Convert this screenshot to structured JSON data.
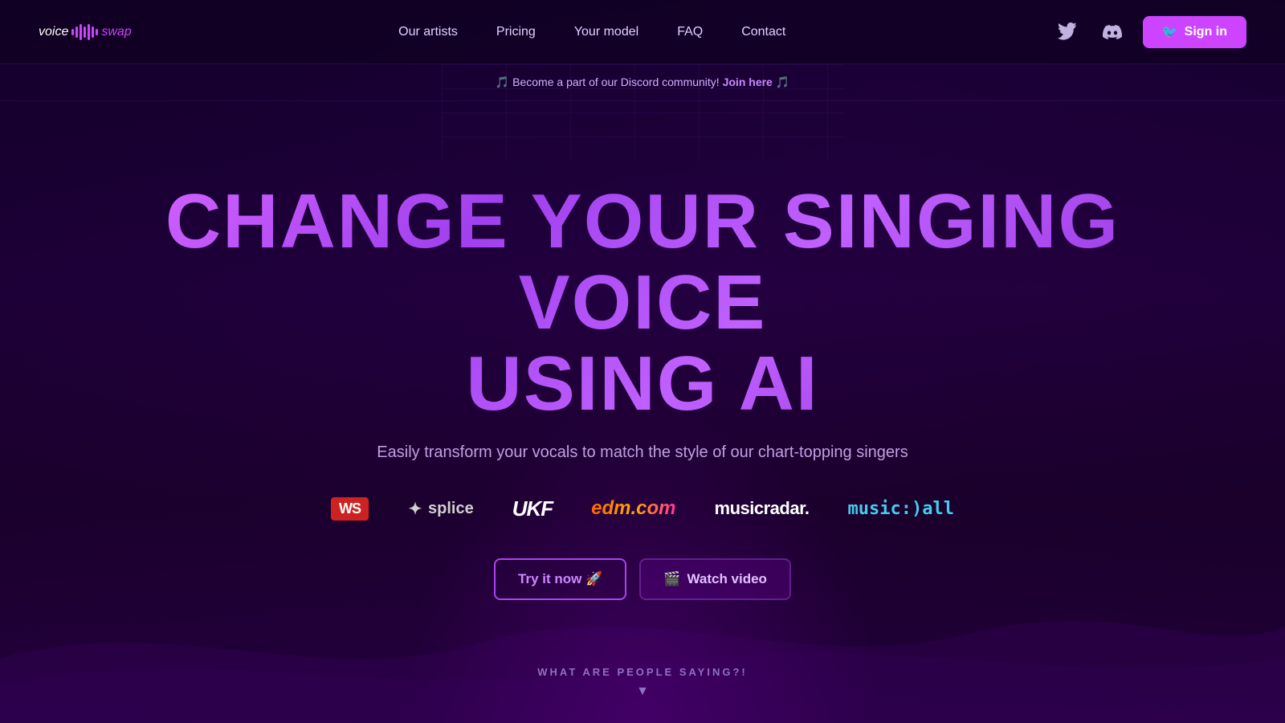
{
  "brand": {
    "name_part1": "voice",
    "name_part2": "swap",
    "waveform_bars": [
      8,
      14,
      20,
      14,
      20,
      14,
      8
    ]
  },
  "nav": {
    "items": [
      {
        "label": "Our artists",
        "href": "#"
      },
      {
        "label": "Pricing",
        "href": "#"
      },
      {
        "label": "Your model",
        "href": "#"
      },
      {
        "label": "FAQ",
        "href": "#"
      },
      {
        "label": "Contact",
        "href": "#"
      }
    ]
  },
  "header": {
    "sign_in_label": "Sign in"
  },
  "banner": {
    "text": "🎵 Become a part of our Discord community!",
    "link_text": "Join here",
    "suffix": "🎵"
  },
  "hero": {
    "title_line1": "CHANGE YOUR SINGING VOICE",
    "title_line2": "USING AI",
    "subtitle": "Easily transform your vocals to match the style of our chart-topping singers"
  },
  "logos": [
    {
      "id": "ws",
      "text": "WS"
    },
    {
      "id": "splice",
      "text": "splice"
    },
    {
      "id": "ukf",
      "text": "UKF"
    },
    {
      "id": "edm",
      "text": "edm.com"
    },
    {
      "id": "musicradar",
      "text": "musicradar."
    },
    {
      "id": "musicall",
      "text": "music:)all"
    }
  ],
  "cta": {
    "try_label": "Try it now 🚀",
    "watch_label": "Watch video"
  },
  "bottom": {
    "label": "WHAT ARE PEOPLE SAYING?!"
  }
}
